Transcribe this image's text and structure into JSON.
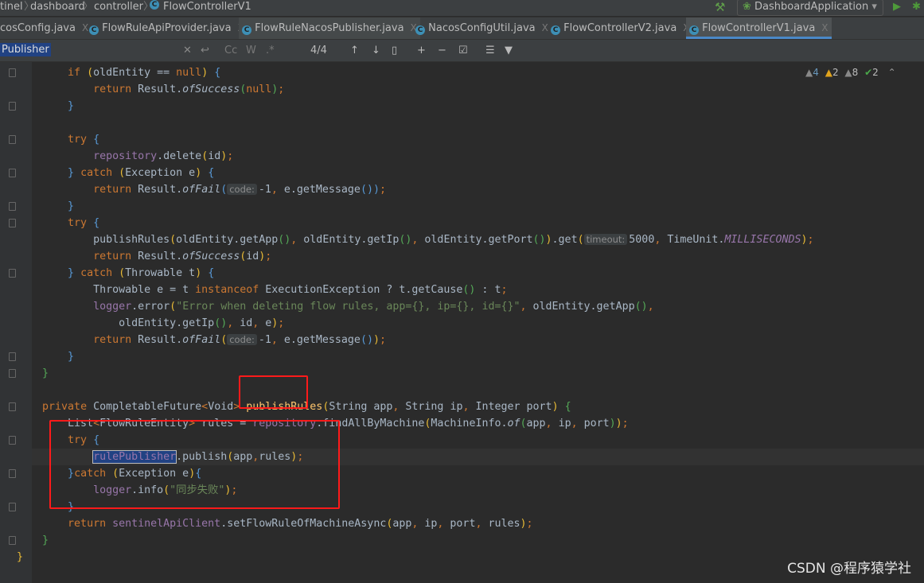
{
  "breadcrumb": [
    "tinel",
    "dashboard",
    "controller",
    "FlowControllerV1"
  ],
  "run_config": "DashboardApplication",
  "tabs": [
    {
      "label": "cosConfig.java"
    },
    {
      "label": "FlowRuleApiProvider.java"
    },
    {
      "label": "FlowRuleNacosPublisher.java"
    },
    {
      "label": "NacosConfigUtil.java"
    },
    {
      "label": "FlowControllerV2.java"
    },
    {
      "label": "FlowControllerV1.java",
      "active": true
    }
  ],
  "search": {
    "query": "Publisher",
    "match_count": "4/4",
    "options": [
      "Cc",
      "W",
      ".*"
    ]
  },
  "inspections": {
    "warnings1": "4",
    "warnings2": "2",
    "weak": "8",
    "typos": "2"
  },
  "watermark": "CSDN @程序猿学社",
  "code": {
    "lines": [
      {
        "i": 2,
        "t": [
          [
            "if ",
            "kw"
          ],
          [
            "(",
            "y"
          ],
          [
            "oldEntity == ",
            ""
          ],
          [
            "null",
            "kw"
          ],
          [
            ") ",
            "y"
          ],
          [
            "{",
            "b"
          ]
        ]
      },
      {
        "i": 3,
        "t": [
          [
            "return ",
            "kw"
          ],
          [
            "Result.",
            ""
          ],
          [
            "ofSuccess",
            "st"
          ],
          [
            "(",
            "g"
          ],
          [
            "null",
            "kw"
          ],
          [
            ")",
            "g"
          ],
          [
            ";",
            "kw"
          ]
        ]
      },
      {
        "i": 2,
        "t": [
          [
            "}",
            "b"
          ]
        ]
      },
      {
        "i": 0,
        "t": []
      },
      {
        "i": 2,
        "t": [
          [
            "try ",
            "kw"
          ],
          [
            "{",
            "b"
          ]
        ]
      },
      {
        "i": 3,
        "t": [
          [
            "repository",
            "fld"
          ],
          [
            ".delete",
            ""
          ],
          [
            "(",
            "y"
          ],
          [
            "id",
            ""
          ],
          [
            ")",
            "y"
          ],
          [
            ";",
            "kw"
          ]
        ]
      },
      {
        "i": 2,
        "t": [
          [
            "} ",
            "b"
          ],
          [
            "catch ",
            "kw"
          ],
          [
            "(",
            "y"
          ],
          [
            "Exception e",
            ""
          ],
          [
            ") ",
            "y"
          ],
          [
            "{",
            "b"
          ]
        ]
      },
      {
        "i": 3,
        "t": [
          [
            "return ",
            "kw"
          ],
          [
            "Result.",
            ""
          ],
          [
            "ofFail",
            "st"
          ],
          [
            "(",
            "b"
          ],
          [
            "code:",
            "hint"
          ],
          [
            "-1",
            ""
          ],
          [
            ", ",
            "kw"
          ],
          [
            "e.getMessage",
            ""
          ],
          [
            "()",
            "b"
          ],
          [
            ")",
            "b"
          ],
          [
            ";",
            "kw"
          ]
        ]
      },
      {
        "i": 2,
        "t": [
          [
            "}",
            "b"
          ]
        ]
      },
      {
        "i": 2,
        "t": [
          [
            "try ",
            "kw"
          ],
          [
            "{",
            "b"
          ]
        ]
      },
      {
        "i": 3,
        "t": [
          [
            "publishRules",
            ""
          ],
          [
            "(",
            "y"
          ],
          [
            "oldEntity.getApp",
            ""
          ],
          [
            "()",
            "g"
          ],
          [
            ", ",
            "kw"
          ],
          [
            "oldEntity.getIp",
            ""
          ],
          [
            "()",
            "g"
          ],
          [
            ", ",
            "kw"
          ],
          [
            "oldEntity.getPort",
            ""
          ],
          [
            "()",
            "g"
          ],
          [
            ")",
            "y"
          ],
          [
            ".get",
            ""
          ],
          [
            "(",
            "y"
          ],
          [
            "timeout:",
            "hint"
          ],
          [
            "5000",
            ""
          ],
          [
            ", ",
            "kw"
          ],
          [
            "TimeUnit.",
            ""
          ],
          [
            "MILLISECONDS",
            "cn"
          ],
          [
            ")",
            "y"
          ],
          [
            ";",
            "kw"
          ]
        ]
      },
      {
        "i": 3,
        "t": [
          [
            "return ",
            "kw"
          ],
          [
            "Result.",
            ""
          ],
          [
            "ofSuccess",
            "st"
          ],
          [
            "(",
            "y"
          ],
          [
            "id",
            ""
          ],
          [
            ")",
            "y"
          ],
          [
            ";",
            "kw"
          ]
        ]
      },
      {
        "i": 2,
        "t": [
          [
            "} ",
            "b"
          ],
          [
            "catch ",
            "kw"
          ],
          [
            "(",
            "y"
          ],
          [
            "Throwable t",
            ""
          ],
          [
            ") ",
            "y"
          ],
          [
            "{",
            "b"
          ]
        ]
      },
      {
        "i": 3,
        "t": [
          [
            "Throwable e = t ",
            ""
          ],
          [
            "instanceof ",
            "kw"
          ],
          [
            "ExecutionException ? t.getCause",
            ""
          ],
          [
            "()",
            "g"
          ],
          [
            " : t",
            ""
          ],
          [
            ";",
            "kw"
          ]
        ]
      },
      {
        "i": 3,
        "t": [
          [
            "logger",
            "fld"
          ],
          [
            ".error",
            ""
          ],
          [
            "(",
            "y"
          ],
          [
            "\"Error when deleting flow rules, app={}, ip={}, id={}\"",
            "str"
          ],
          [
            ", ",
            "kw"
          ],
          [
            "oldEntity.getApp",
            ""
          ],
          [
            "()",
            "g"
          ],
          [
            ",",
            "kw"
          ]
        ]
      },
      {
        "i": 4,
        "t": [
          [
            "oldEntity.getIp",
            ""
          ],
          [
            "()",
            "g"
          ],
          [
            ", ",
            "kw"
          ],
          [
            "id",
            ""
          ],
          [
            ", ",
            "kw"
          ],
          [
            "e",
            ""
          ],
          [
            ")",
            "y"
          ],
          [
            ";",
            "kw"
          ]
        ]
      },
      {
        "i": 3,
        "t": [
          [
            "return ",
            "kw"
          ],
          [
            "Result.",
            ""
          ],
          [
            "ofFail",
            "st"
          ],
          [
            "(",
            "y"
          ],
          [
            "code:",
            "hint"
          ],
          [
            "-1",
            ""
          ],
          [
            ", ",
            "kw"
          ],
          [
            "e.getMessage",
            ""
          ],
          [
            "()",
            "b"
          ],
          [
            ")",
            "y"
          ],
          [
            ";",
            "kw"
          ]
        ]
      },
      {
        "i": 2,
        "t": [
          [
            "}",
            "b"
          ]
        ]
      },
      {
        "i": 1,
        "t": [
          [
            "}",
            "g"
          ]
        ]
      },
      {
        "i": 0,
        "t": []
      },
      {
        "i": 1,
        "t": [
          [
            "private ",
            "kw"
          ],
          [
            "CompletableFuture",
            ""
          ],
          [
            "<",
            "kw"
          ],
          [
            "Void",
            ""
          ],
          [
            "> ",
            "kw"
          ],
          [
            "publishRules",
            "mf"
          ],
          [
            "(",
            "y"
          ],
          [
            "String app",
            ""
          ],
          [
            ", ",
            "kw"
          ],
          [
            "String ip",
            ""
          ],
          [
            ", ",
            "kw"
          ],
          [
            "Integer port",
            ""
          ],
          [
            ") ",
            "y"
          ],
          [
            "{",
            "g"
          ]
        ]
      },
      {
        "i": 2,
        "t": [
          [
            "List",
            ""
          ],
          [
            "<",
            "kw"
          ],
          [
            "FlowRuleEntity",
            ""
          ],
          [
            "> ",
            "kw"
          ],
          [
            "rules = ",
            ""
          ],
          [
            "repository",
            "fld"
          ],
          [
            ".findAllByMachine",
            ""
          ],
          [
            "(",
            "y"
          ],
          [
            "MachineInfo.",
            ""
          ],
          [
            "of",
            "st"
          ],
          [
            "(",
            "g"
          ],
          [
            "app",
            ""
          ],
          [
            ", ",
            "kw"
          ],
          [
            "ip",
            ""
          ],
          [
            ", ",
            "kw"
          ],
          [
            "port",
            ""
          ],
          [
            ")",
            "g"
          ],
          [
            ")",
            "y"
          ],
          [
            ";",
            "kw"
          ]
        ]
      },
      {
        "i": 2,
        "t": [
          [
            "try ",
            "kw"
          ],
          [
            "{",
            "b"
          ]
        ]
      },
      {
        "i": 3,
        "t": [
          [
            "rulePublisher",
            "fld sel"
          ],
          [
            ".publish",
            ""
          ],
          [
            "(",
            "y"
          ],
          [
            "app",
            ""
          ],
          [
            ",",
            "kw"
          ],
          [
            "rules",
            ""
          ],
          [
            ")",
            "y"
          ],
          [
            ";",
            "kw"
          ]
        ]
      },
      {
        "i": 2,
        "t": [
          [
            "}",
            "b"
          ],
          [
            "catch ",
            "kw"
          ],
          [
            "(",
            "y"
          ],
          [
            "Exception e",
            ""
          ],
          [
            ")",
            "y"
          ],
          [
            "{",
            "b"
          ]
        ]
      },
      {
        "i": 3,
        "t": [
          [
            "logger",
            "fld"
          ],
          [
            ".info",
            ""
          ],
          [
            "(",
            "y"
          ],
          [
            "\"同步失败\"",
            "str"
          ],
          [
            ")",
            "y"
          ],
          [
            ";",
            "kw"
          ]
        ]
      },
      {
        "i": 2,
        "t": [
          [
            "}",
            "b"
          ]
        ]
      },
      {
        "i": 2,
        "t": [
          [
            "return ",
            "kw"
          ],
          [
            "sentinelApiClient",
            "fld"
          ],
          [
            ".setFlowRuleOfMachineAsync",
            ""
          ],
          [
            "(",
            "y"
          ],
          [
            "app",
            ""
          ],
          [
            ", ",
            "kw"
          ],
          [
            "ip",
            ""
          ],
          [
            ", ",
            "kw"
          ],
          [
            "port",
            ""
          ],
          [
            ", ",
            "kw"
          ],
          [
            "rules",
            ""
          ],
          [
            ")",
            "y"
          ],
          [
            ";",
            "kw"
          ]
        ]
      },
      {
        "i": 1,
        "t": [
          [
            "}",
            "g"
          ]
        ]
      },
      {
        "i": 0,
        "t": [
          [
            "}",
            "y"
          ]
        ]
      }
    ]
  },
  "colors": {
    "background": "#2b2b2b",
    "keyword": "#cc7832",
    "field": "#9876aa",
    "string": "#6a8759",
    "annotation_box": "#ff1a1a"
  }
}
